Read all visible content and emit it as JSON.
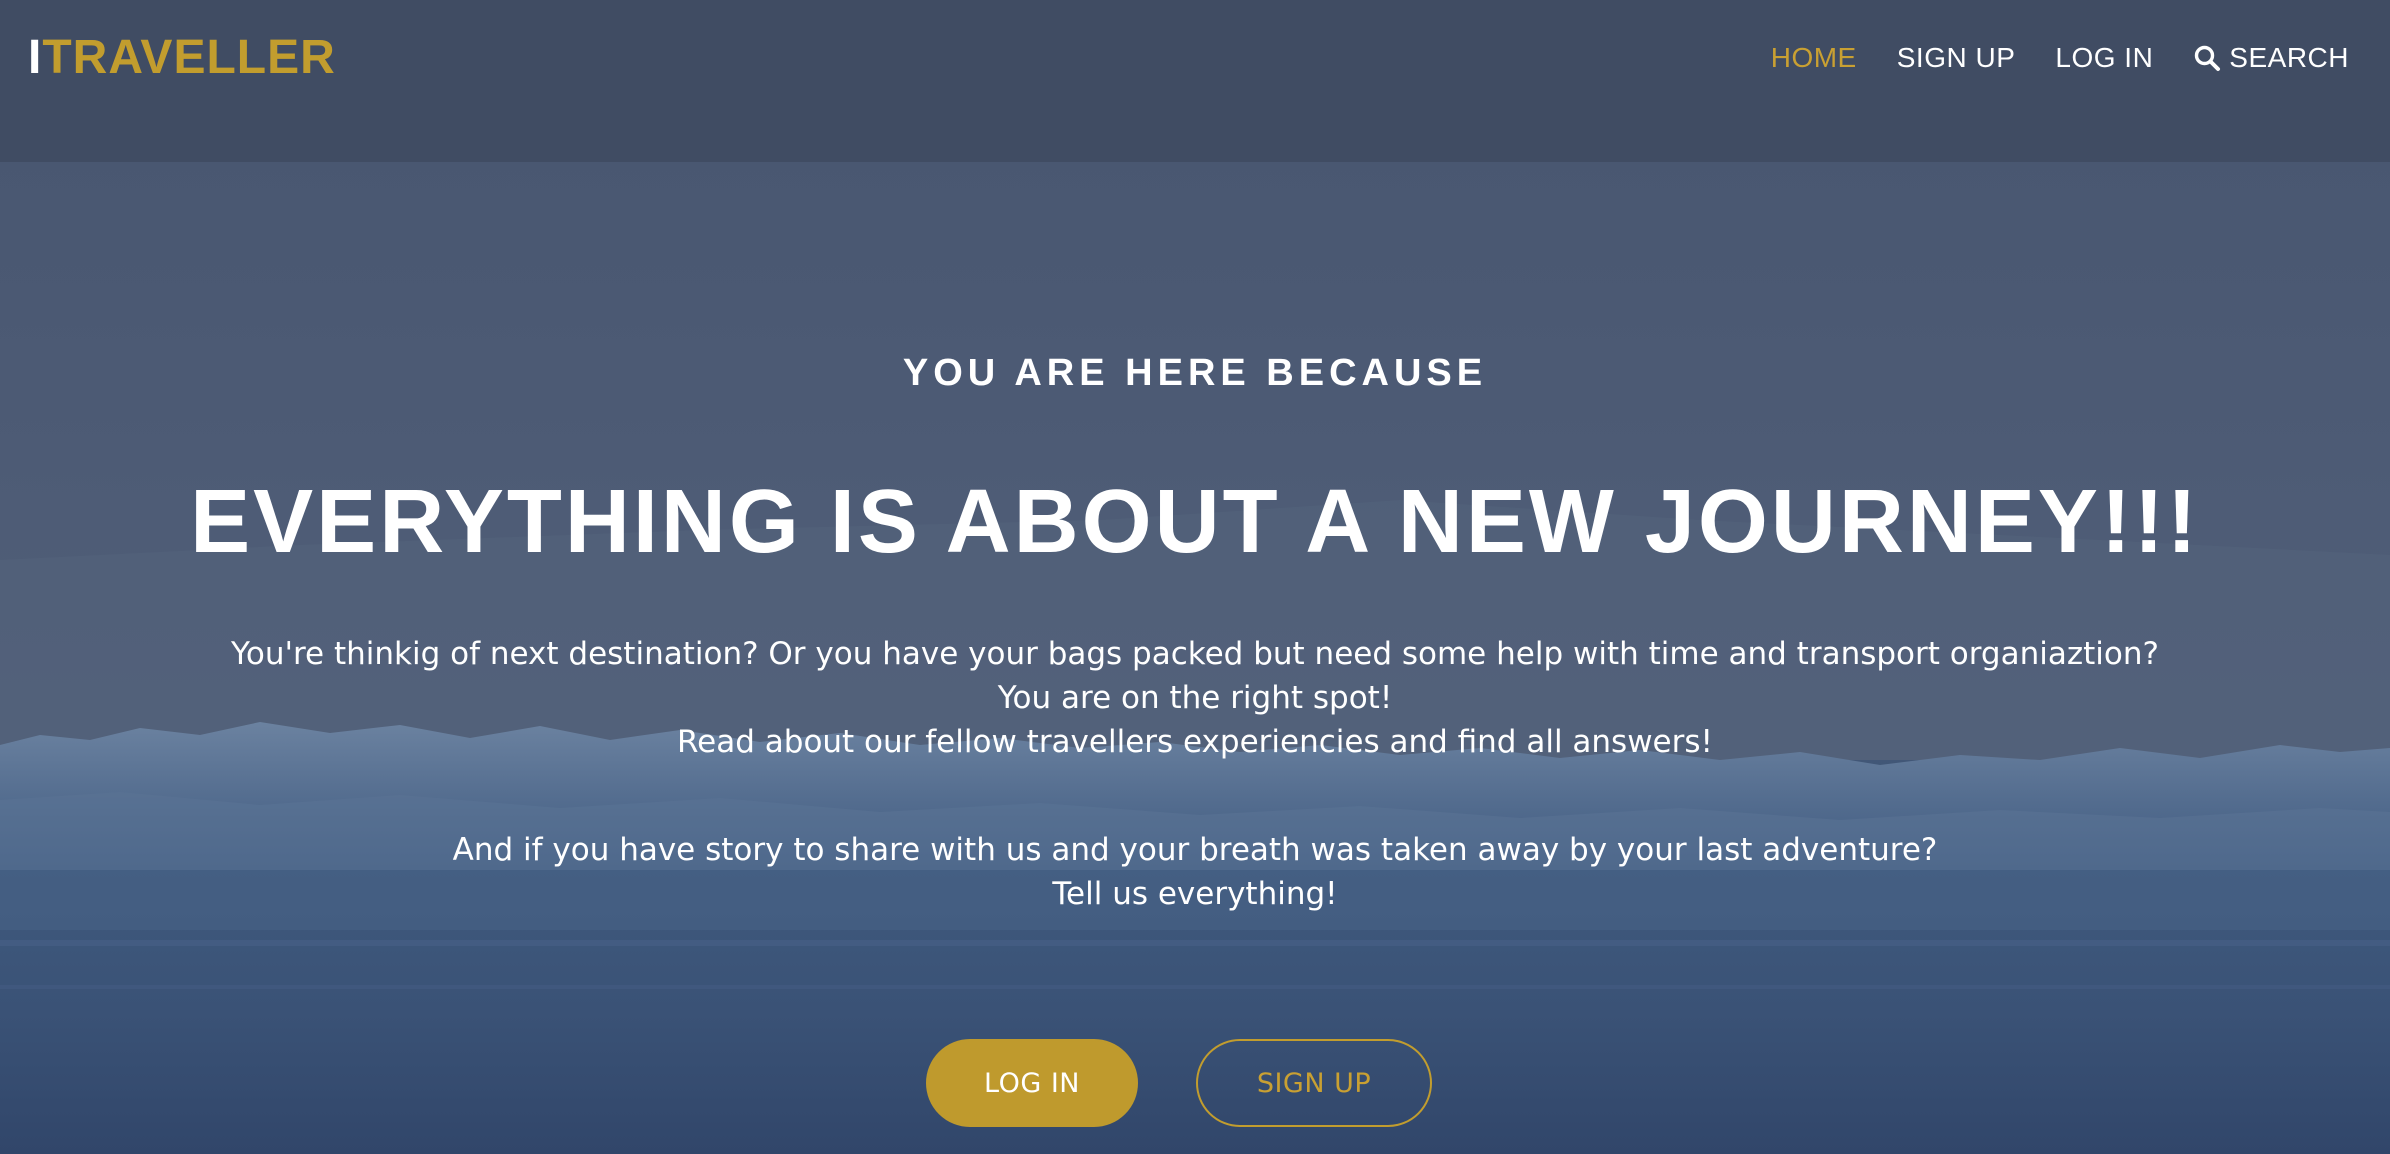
{
  "brand": {
    "logo_prefix": "I",
    "logo_rest": "TRAVELLER",
    "accent_color": "#c29d2e"
  },
  "nav": {
    "items": [
      {
        "label": "HOME",
        "active": true
      },
      {
        "label": "SIGN UP",
        "active": false
      },
      {
        "label": "LOG IN",
        "active": false
      },
      {
        "label": "SEARCH",
        "active": false,
        "icon": "search-icon"
      }
    ]
  },
  "hero": {
    "eyebrow": "YOU ARE HERE BECAUSE",
    "headline": "EVERYTHING IS ABOUT A NEW JOURNEY!!!",
    "paragraph1": [
      "You're thinkig of next destination? Or you have your bags packed but need some help with time and transport organiaztion?",
      "You are on the right spot!",
      "Read about our fellow travellers experiencies and find all answers!"
    ],
    "paragraph2": [
      "And if you have story to share with us and your breath was taken away by your last adventure?",
      "Tell us everything!"
    ],
    "buttons": {
      "login_label": "LOG IN",
      "signup_label": "SIGN UP"
    }
  }
}
